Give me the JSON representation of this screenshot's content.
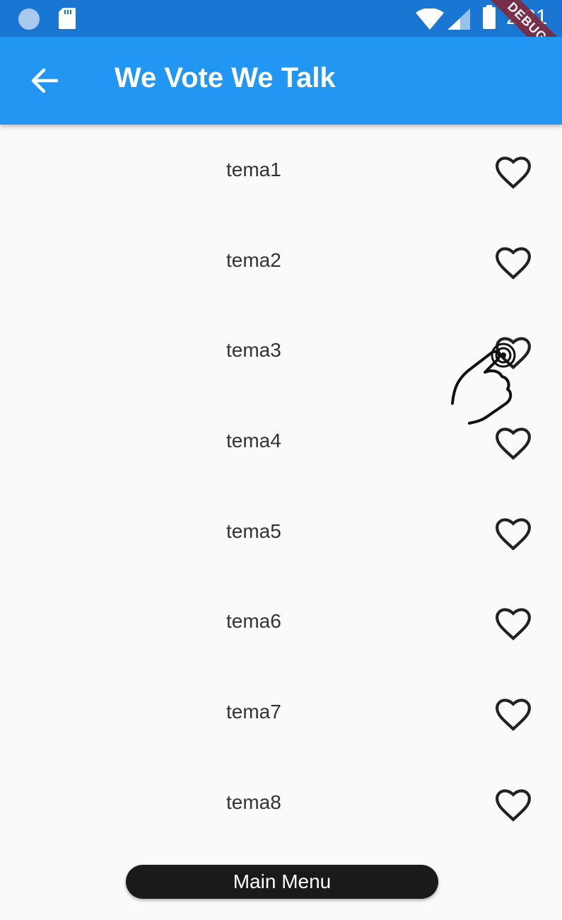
{
  "status_bar": {
    "time": "2:21",
    "icons": [
      "loading-icon",
      "sd-card-icon",
      "wifi-icon",
      "signal-icon",
      "battery-icon"
    ]
  },
  "app_bar": {
    "title": "We Vote We Talk",
    "back_icon": "arrow-back-icon"
  },
  "debug_banner": "DEBUG",
  "list": {
    "items": [
      {
        "label": "tema1",
        "icon": "heart-outline-icon"
      },
      {
        "label": "tema2",
        "icon": "heart-outline-icon"
      },
      {
        "label": "tema3",
        "icon": "heart-outline-icon"
      },
      {
        "label": "tema4",
        "icon": "heart-outline-icon"
      },
      {
        "label": "tema5",
        "icon": "heart-outline-icon"
      },
      {
        "label": "tema6",
        "icon": "heart-outline-icon"
      },
      {
        "label": "tema7",
        "icon": "heart-outline-icon"
      },
      {
        "label": "tema8",
        "icon": "heart-outline-icon"
      }
    ]
  },
  "main_menu": {
    "label": "Main Menu"
  },
  "colors": {
    "status_bar": "#1976d2",
    "app_bar": "#2196f3",
    "background": "#fafafa",
    "button": "#1a1a1a",
    "debug_banner": "#7d2a3d"
  }
}
